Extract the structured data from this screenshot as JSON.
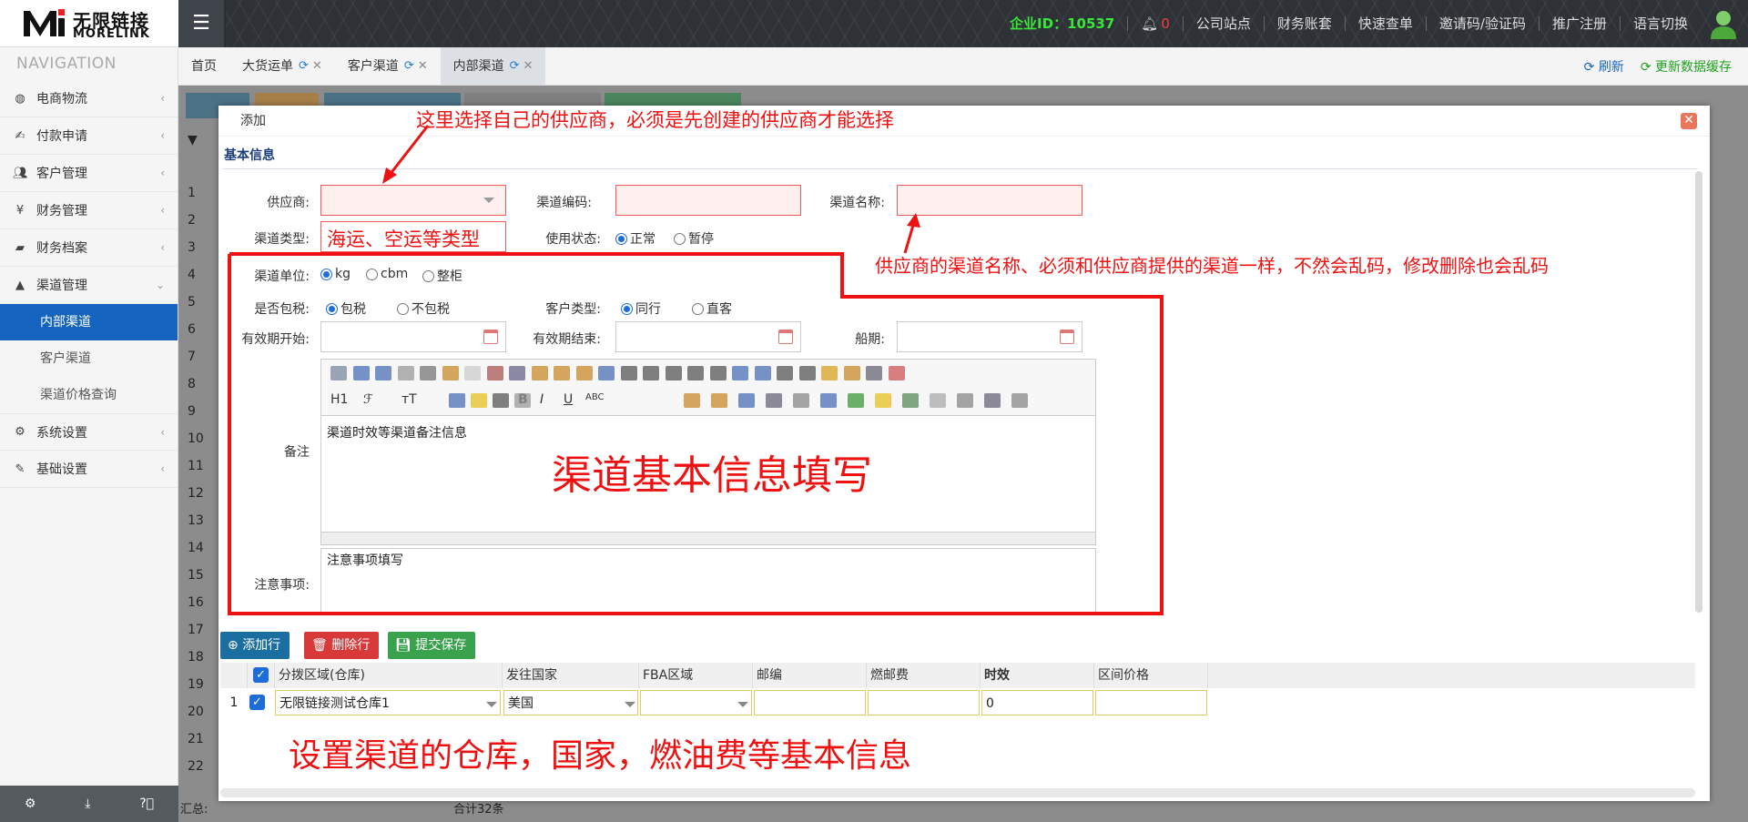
{
  "brand": {
    "name_cn": "无限链接",
    "name_en": "MORELINK"
  },
  "topnav": {
    "company_id": "企业ID：10537",
    "notification_count": "0",
    "links": [
      "公司站点",
      "财务账套",
      "快速查单",
      "邀请码/验证码",
      "推广注册",
      "语言切换"
    ]
  },
  "sidebar": {
    "title": "NAVIGATION",
    "groups": [
      {
        "label": "电商物流",
        "icon": "globe-icon"
      },
      {
        "label": "付款申请",
        "icon": "payment-icon"
      },
      {
        "label": "客户管理",
        "icon": "users-icon"
      },
      {
        "label": "财务管理",
        "icon": "yen-icon"
      },
      {
        "label": "财务档案",
        "icon": "book-icon"
      },
      {
        "label": "渠道管理",
        "icon": "road-icon"
      }
    ],
    "sub_items": [
      "内部渠道",
      "客户渠道",
      "渠道价格查询"
    ],
    "groups_after": [
      {
        "label": "系统设置",
        "icon": "gear-icon"
      },
      {
        "label": "基础设置",
        "icon": "edit-icon"
      }
    ]
  },
  "tabs": {
    "items": [
      "首页",
      "大货运单",
      "客户渠道",
      "内部渠道"
    ],
    "refresh": "刷新",
    "update_cache": "更新数据缓存"
  },
  "background_grid": {
    "row_numbers": [
      "1",
      "2",
      "3",
      "4",
      "5",
      "6",
      "7",
      "8",
      "9",
      "10",
      "11",
      "12",
      "13",
      "14",
      "15",
      "16",
      "17",
      "18",
      "19",
      "20",
      "21",
      "22"
    ],
    "footer_label": "汇总:",
    "footer_total": "合计32条"
  },
  "modal": {
    "title": "添加",
    "section": "基本信息",
    "labels": {
      "supplier": "供应商:",
      "channel_code": "渠道编码:",
      "channel_name": "渠道名称:",
      "channel_type": "渠道类型:",
      "use_status": "使用状态:",
      "channel_unit": "渠道单位:",
      "tax_included": "是否包税:",
      "customer_type": "客户类型:",
      "valid_start": "有效期开始:",
      "valid_end": "有效期结束:",
      "sailing": "船期:",
      "remarks": "备注",
      "notes": "注意事项:"
    },
    "status_options": [
      "正常",
      "暂停"
    ],
    "unit_options": [
      "kg",
      "cbm",
      "整柜"
    ],
    "tax_options": [
      "包税",
      "不包税"
    ],
    "customer_type_options": [
      "同行",
      "直客"
    ],
    "editor_toolbar": {
      "h1": "H1",
      "font_family": "ℱ",
      "font_size": "тT",
      "bold": "B",
      "italic": "I",
      "underline": "U",
      "strike": "ABC"
    },
    "remarks_text": "渠道时效等渠道备注信息",
    "notes_text": "注意事项填写",
    "buttons": {
      "add_row": "添加行",
      "delete_row": "删除行",
      "submit": "提交保存"
    },
    "grid_headers": [
      "分拨区域(仓库)",
      "发往国家",
      "FBA区域",
      "邮编",
      "燃邮费",
      "时效",
      "区间价格"
    ],
    "grid_row": {
      "index": "1",
      "warehouse": "无限链接测试仓库1",
      "country": "美国",
      "fba": "",
      "zip": "",
      "fuel": "",
      "time": "0",
      "price": ""
    }
  },
  "annotations": {
    "supplier_note": "这里选择自己的供应商，必须是先创建的供应商才能选择",
    "channel_type_note": "海运、空运等类型",
    "channel_name_note": "供应商的渠道名称、必须和供应商提供的渠道一样，不然会乱码，修改删除也会乱码",
    "basic_info_note": "渠道基本信息填写",
    "warehouse_note": "设置渠道的仓库，国家，燃油费等基本信息"
  },
  "colors": {
    "annotation": "#ee1111",
    "accent": "#1565c0",
    "company_id": "#39e639",
    "add_btn": "#1a6ea0",
    "delete_btn": "#d83a3a",
    "submit_btn": "#3aa24c"
  }
}
